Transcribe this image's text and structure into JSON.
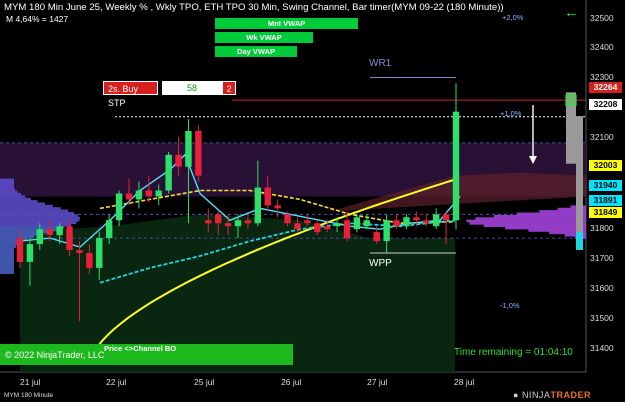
{
  "header": {
    "title": "MYM 180 Min June 25, Weekly % , Wkly TPO, ETH TPO 30 Min, Swing Channel, Bar timer(MYM 09-22 (180 Minute))",
    "sub": "M 4,64% = 1427"
  },
  "vwap_labels": [
    "Mnt VWAP",
    "Wk VWAP",
    "Day VWAP"
  ],
  "pct_labels": [
    "+2,0%",
    "+1,0%",
    "-1,0%"
  ],
  "order": {
    "label": "2s. Buy STP",
    "qty": "58",
    "count": "2"
  },
  "annotations": {
    "wr1": "WR1",
    "wpp": "WPP"
  },
  "price_axis": [
    "32500",
    "32400",
    "32300",
    "32100",
    "31900",
    "31800",
    "31700",
    "31600",
    "31500",
    "31400"
  ],
  "price_tags": [
    {
      "text": "32264",
      "bg": "#d62020",
      "fg": "#ffffff"
    },
    {
      "text": "32208",
      "bg": "#ffffff",
      "fg": "#000000"
    },
    {
      "text": "32003",
      "bg": "#ffff00",
      "fg": "#000000"
    },
    {
      "text": "31940",
      "bg": "#00e5ff",
      "fg": "#000000"
    },
    {
      "text": "31891",
      "bg": "#00e5ff",
      "fg": "#000000"
    },
    {
      "text": "31849",
      "bg": "#ffff00",
      "fg": "#000000"
    }
  ],
  "date_axis": [
    "21 jul",
    "22 jul",
    "25 jul",
    "26 jul",
    "27 jul",
    "28 jul"
  ],
  "bo": {
    "copyright": "© 2022 NinjaTrader, LLC",
    "channel": "Price <>Channel BO"
  },
  "timer": "Time remaining = 01:04:10",
  "footer": "MYM 180 Minute",
  "logo": {
    "a": "NINJA",
    "b": "TRADER"
  },
  "chart_data": {
    "type": "candlestick",
    "ylim": [
      31350,
      32560
    ],
    "candles": [
      {
        "o": 31800,
        "h": 31830,
        "l": 31700,
        "c": 31720
      },
      {
        "o": 31720,
        "h": 31800,
        "l": 31640,
        "c": 31780
      },
      {
        "o": 31780,
        "h": 31850,
        "l": 31760,
        "c": 31830
      },
      {
        "o": 31830,
        "h": 31860,
        "l": 31790,
        "c": 31810
      },
      {
        "o": 31810,
        "h": 31850,
        "l": 31780,
        "c": 31840
      },
      {
        "o": 31840,
        "h": 31860,
        "l": 31740,
        "c": 31760
      },
      {
        "o": 31760,
        "h": 31790,
        "l": 31520,
        "c": 31750
      },
      {
        "o": 31750,
        "h": 31780,
        "l": 31680,
        "c": 31700
      },
      {
        "o": 31700,
        "h": 31820,
        "l": 31660,
        "c": 31800
      },
      {
        "o": 31800,
        "h": 31880,
        "l": 31780,
        "c": 31860
      },
      {
        "o": 31860,
        "h": 31960,
        "l": 31840,
        "c": 31950
      },
      {
        "o": 31950,
        "h": 32000,
        "l": 31910,
        "c": 31930
      },
      {
        "o": 31930,
        "h": 31990,
        "l": 31900,
        "c": 31960
      },
      {
        "o": 31960,
        "h": 32010,
        "l": 31920,
        "c": 31940
      },
      {
        "o": 31940,
        "h": 31980,
        "l": 31910,
        "c": 31960
      },
      {
        "o": 31960,
        "h": 32090,
        "l": 31950,
        "c": 32080
      },
      {
        "o": 32080,
        "h": 32140,
        "l": 32010,
        "c": 32040
      },
      {
        "o": 32040,
        "h": 32200,
        "l": 31850,
        "c": 32160
      },
      {
        "o": 32160,
        "h": 32180,
        "l": 31990,
        "c": 32010
      },
      {
        "o": 31860,
        "h": 31900,
        "l": 31820,
        "c": 31850
      },
      {
        "o": 31880,
        "h": 31890,
        "l": 31810,
        "c": 31850
      },
      {
        "o": 31850,
        "h": 31880,
        "l": 31810,
        "c": 31840
      },
      {
        "o": 31840,
        "h": 31880,
        "l": 31800,
        "c": 31860
      },
      {
        "o": 31860,
        "h": 31880,
        "l": 31830,
        "c": 31850
      },
      {
        "o": 31850,
        "h": 32060,
        "l": 31840,
        "c": 31970
      },
      {
        "o": 31970,
        "h": 32010,
        "l": 31890,
        "c": 31910
      },
      {
        "o": 31910,
        "h": 31930,
        "l": 31870,
        "c": 31900
      },
      {
        "o": 31880,
        "h": 31890,
        "l": 31840,
        "c": 31850
      },
      {
        "o": 31850,
        "h": 31870,
        "l": 31820,
        "c": 31830
      },
      {
        "o": 31860,
        "h": 31880,
        "l": 31840,
        "c": 31850
      },
      {
        "o": 31850,
        "h": 31860,
        "l": 31810,
        "c": 31820
      },
      {
        "o": 31840,
        "h": 31860,
        "l": 31820,
        "c": 31830
      },
      {
        "o": 31840,
        "h": 31870,
        "l": 31820,
        "c": 31850
      },
      {
        "o": 31860,
        "h": 31890,
        "l": 31790,
        "c": 31800
      },
      {
        "o": 31830,
        "h": 31880,
        "l": 31820,
        "c": 31870
      },
      {
        "o": 31840,
        "h": 31880,
        "l": 31830,
        "c": 31860
      },
      {
        "o": 31820,
        "h": 31840,
        "l": 31780,
        "c": 31790
      },
      {
        "o": 31790,
        "h": 31880,
        "l": 31750,
        "c": 31860
      },
      {
        "o": 31860,
        "h": 31880,
        "l": 31830,
        "c": 31840
      },
      {
        "o": 31840,
        "h": 31880,
        "l": 31830,
        "c": 31870
      },
      {
        "o": 31870,
        "h": 31890,
        "l": 31840,
        "c": 31860
      },
      {
        "o": 31860,
        "h": 31880,
        "l": 31840,
        "c": 31850
      },
      {
        "o": 31840,
        "h": 31900,
        "l": 31830,
        "c": 31880
      },
      {
        "o": 31880,
        "h": 31890,
        "l": 31780,
        "c": 31860
      },
      {
        "o": 31860,
        "h": 32320,
        "l": 31830,
        "c": 32225
      }
    ]
  }
}
